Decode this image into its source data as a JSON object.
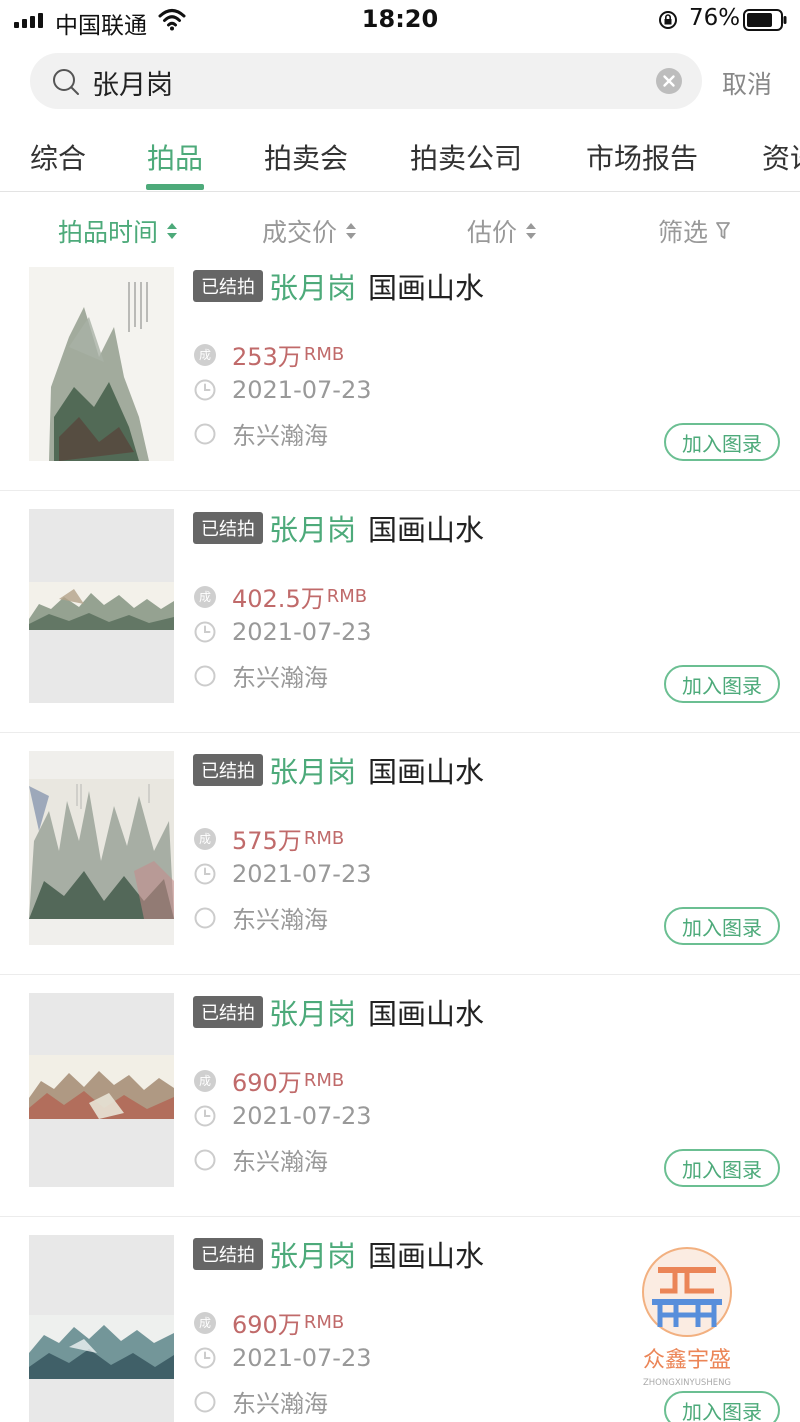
{
  "status_bar": {
    "carrier": "中国联通",
    "time": "18:20",
    "battery": "76%"
  },
  "search": {
    "query": "张月岗",
    "cancel": "取消"
  },
  "tabs": [
    {
      "label": "综合"
    },
    {
      "label": "拍品"
    },
    {
      "label": "拍卖会"
    },
    {
      "label": "拍卖公司"
    },
    {
      "label": "市场报告"
    },
    {
      "label": "资讯"
    }
  ],
  "sort": {
    "time": "拍品时间",
    "price": "成交价",
    "estimate": "估价",
    "filter": "筛选"
  },
  "lots": [
    {
      "status": "已结拍",
      "artist": "张月岗",
      "title": "国画山水",
      "price": "253万",
      "unit": "RMB",
      "date": "2021-07-23",
      "house": "东兴瀚海",
      "action": "加入图录"
    },
    {
      "status": "已结拍",
      "artist": "张月岗",
      "title": "国画山水",
      "price": "402.5万",
      "unit": "RMB",
      "date": "2021-07-23",
      "house": "东兴瀚海",
      "action": "加入图录"
    },
    {
      "status": "已结拍",
      "artist": "张月岗",
      "title": "国画山水",
      "price": "575万",
      "unit": "RMB",
      "date": "2021-07-23",
      "house": "东兴瀚海",
      "action": "加入图录"
    },
    {
      "status": "已结拍",
      "artist": "张月岗",
      "title": "国画山水",
      "price": "690万",
      "unit": "RMB",
      "date": "2021-07-23",
      "house": "东兴瀚海",
      "action": "加入图录"
    },
    {
      "status": "已结拍",
      "artist": "张月岗",
      "title": "国画山水",
      "price": "690万",
      "unit": "RMB",
      "date": "2021-07-23",
      "house": "东兴瀚海",
      "action": "加入图录"
    }
  ],
  "price_icon_glyph": "成",
  "watermark": {
    "name": "众鑫宇盛",
    "pinyin": "ZHONGXINYUSHENG"
  },
  "colors": {
    "accent": "#4daa7a",
    "price": "#c06a6a",
    "badge": "#666666"
  }
}
